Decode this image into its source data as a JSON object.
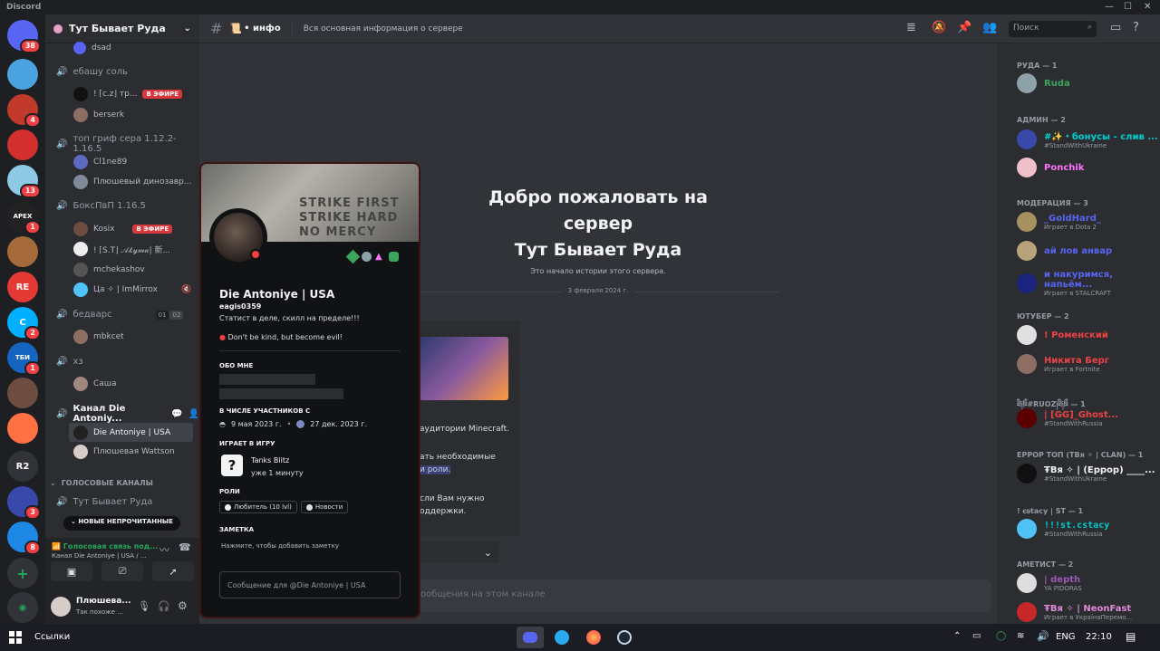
{
  "titlebar": {
    "app": "Discord"
  },
  "server": {
    "name": "Тут Бывает Руда"
  },
  "servers": [
    {
      "badge": "38",
      "color": "#5865f2"
    },
    {
      "badge": "",
      "color": "#4aa3df"
    },
    {
      "badge": "4",
      "color": "#c0392b"
    },
    {
      "badge": "",
      "color": "#d32f2f"
    },
    {
      "badge": "13",
      "color": "#8ecae6"
    },
    {
      "badge": "1",
      "color": "#222222",
      "label": "APEX"
    },
    {
      "badge": "",
      "color": "#a56a3a"
    },
    {
      "badge": "",
      "color": "#e53935",
      "label": "RE"
    },
    {
      "badge": "2",
      "color": "#00b0ff",
      "label": "C"
    },
    {
      "badge": "1",
      "color": "#1565c0",
      "label": "ТБИ"
    },
    {
      "badge": "",
      "color": "#6d4c41"
    },
    {
      "badge": "",
      "color": "#ff7043"
    },
    {
      "badge": "",
      "color": "#313338",
      "label": "R2"
    },
    {
      "badge": "3",
      "color": "#3949ab"
    },
    {
      "badge": "8",
      "color": "#1e88e5"
    }
  ],
  "channels": {
    "top_user": "dsad",
    "voice": [
      {
        "name": "ебашу соль",
        "users": [
          {
            "name": "! ⌈c.z⌋ тр...",
            "live": true
          },
          {
            "name": "berserk"
          }
        ]
      },
      {
        "name": "топ гриф сера 1.12.2-1.16.5",
        "users": [
          {
            "name": "Cl1ne89"
          },
          {
            "name": "Плюшевый динозавр..."
          }
        ]
      },
      {
        "name": "БоксПвП 1.16.5",
        "users": [
          {
            "name": "Kosix",
            "live": true
          },
          {
            "name": "! ⌈S.T⌋ 𝒜𝓀𝓎𝓂𝒶| 新..."
          },
          {
            "name": "mchekashov"
          },
          {
            "name": "Ца ✧ | ImMirrox"
          }
        ]
      },
      {
        "name": "бедварс",
        "counts": [
          "01",
          "02"
        ],
        "users": [
          {
            "name": "mbkcet"
          }
        ]
      },
      {
        "name": "хз",
        "users": [
          {
            "name": "Саша"
          }
        ]
      },
      {
        "name": "Канал Die Antoniy...",
        "users": [
          {
            "name": "Die Antoniye | USA"
          },
          {
            "name": "Плюшевая Wattson"
          }
        ]
      }
    ],
    "category": "ГОЛОСОВЫЕ КАНАЛЫ",
    "last_voice": "Тут Бывает Руда",
    "unread_pill": "НОВЫЕ НЕПРОЧИТАННЫЕ",
    "live_label": "В ЭФИРЕ"
  },
  "voice_panel": {
    "status": "Голосовая связь под...",
    "channel": "Канал Die Antoniye | USA / ..."
  },
  "user_panel": {
    "name": "Плюшева...",
    "status": "Так похоже ..."
  },
  "topbar": {
    "channel": "• инфо",
    "topic": "Вся основная информация о сервере",
    "search_placeholder": "Поиск"
  },
  "welcome": {
    "line1": "Добро пожаловать на",
    "line2": "сервер",
    "line3": "Тут Бывает Руда",
    "sub": "Это начало истории этого сервера.",
    "date": "3 февраля 2024 г."
  },
  "bg_text": {
    "t1": "аудитории Minecraft.",
    "t2": "ать необходимые",
    "t3": "и роли.",
    "t4": "сли Вам нужно",
    "t5": "оддержки.",
    "input": "ообщения на этом канале"
  },
  "profile": {
    "display": "Die Antoniye | USA",
    "username": "eagis0359",
    "bio": "Статист в деле, скилл на пределе!!!",
    "status": "Don't be kind, but become evil!",
    "about": "ОБО МНЕ",
    "member_since": "В ЧИСЛЕ УЧАСТНИКОВ С",
    "date1": "9 мая 2023 г.",
    "date2": "27 дек. 2023 г.",
    "playing": "ИГРАЕТ В ИГРУ",
    "game": "Tanks Blitz",
    "game_time": "уже 1 минуту",
    "roles_title": "РОЛИ",
    "roles": [
      "Любитель (10 lvl)",
      "Новости"
    ],
    "note_title": "ЗАМЕТКА",
    "note": "Нажмите, чтобы добавить заметку",
    "message": "Сообщение для @Die Antoniye | USA",
    "banner_text": "STRIKE FIRST\nSTRIKE HARD\nNO MERCY"
  },
  "members": {
    "groups": [
      {
        "title": "РУДА — 1",
        "items": [
          {
            "name": "Ruda",
            "color": "#3ba55c"
          }
        ]
      },
      {
        "title": "АДМИН — 2",
        "items": [
          {
            "name": "#✨・бонусы - слив ...",
            "sub": "#StandWithUkraine",
            "color": "#00d0d0"
          },
          {
            "name": "Ponchik",
            "color": "#ff73fa"
          }
        ]
      },
      {
        "title": "МОДЕРАЦИЯ — 3",
        "items": [
          {
            "name": "_GoldHard_",
            "sub": "Играет в Dota 2",
            "color": "#5865f2"
          },
          {
            "name": "ай лов анвар",
            "color": "#5865f2"
          },
          {
            "name": "и накуримся, напьём...",
            "sub": "Играет в STALCRAFT",
            "color": "#5865f2"
          }
        ]
      },
      {
        "title": "ЮТУБЕР — 2",
        "items": [
          {
            "name": "! Роменский",
            "color": "#ed4245"
          },
          {
            "name": "Никита Берг",
            "sub": "Играет в Fortnite",
            "color": "#ed4245"
          }
        ]
      },
      {
        "title": "ཐི༏ཋྀ#RUOZ༏ཐི༏ཋྀ — 1",
        "items": [
          {
            "name": "| [GG]_Ghost...",
            "sub": "#StandWithRussia",
            "color": "#ed4245"
          }
        ]
      },
      {
        "title": "ЕРРОР ТОП (ТВя ✧ | CLAN) — 1",
        "items": [
          {
            "name": "ŦBя ✧ | (Еррор) ____...",
            "sub": "#StandWithUkraine",
            "color": "#f2f3f5"
          }
        ]
      },
      {
        "title": "! ꞓꞩtacy | ST — 1",
        "items": [
          {
            "name": "!!!st.cstacy",
            "sub": "#StandWithRussia",
            "color": "#00d0d0"
          }
        ]
      },
      {
        "title": "АМЕТИСТ — 2",
        "items": [
          {
            "name": "| depth",
            "sub": "YA PIDORAS",
            "color": "#9b59b6"
          },
          {
            "name": "ŦBя ✧ | NeonFast",
            "sub": "Играет в УкраїнаПеремо...",
            "color": "#9b59b6"
          }
        ]
      }
    ]
  },
  "taskbar": {
    "links": "Ссылки",
    "lang": "ENG",
    "time": "22:10"
  }
}
